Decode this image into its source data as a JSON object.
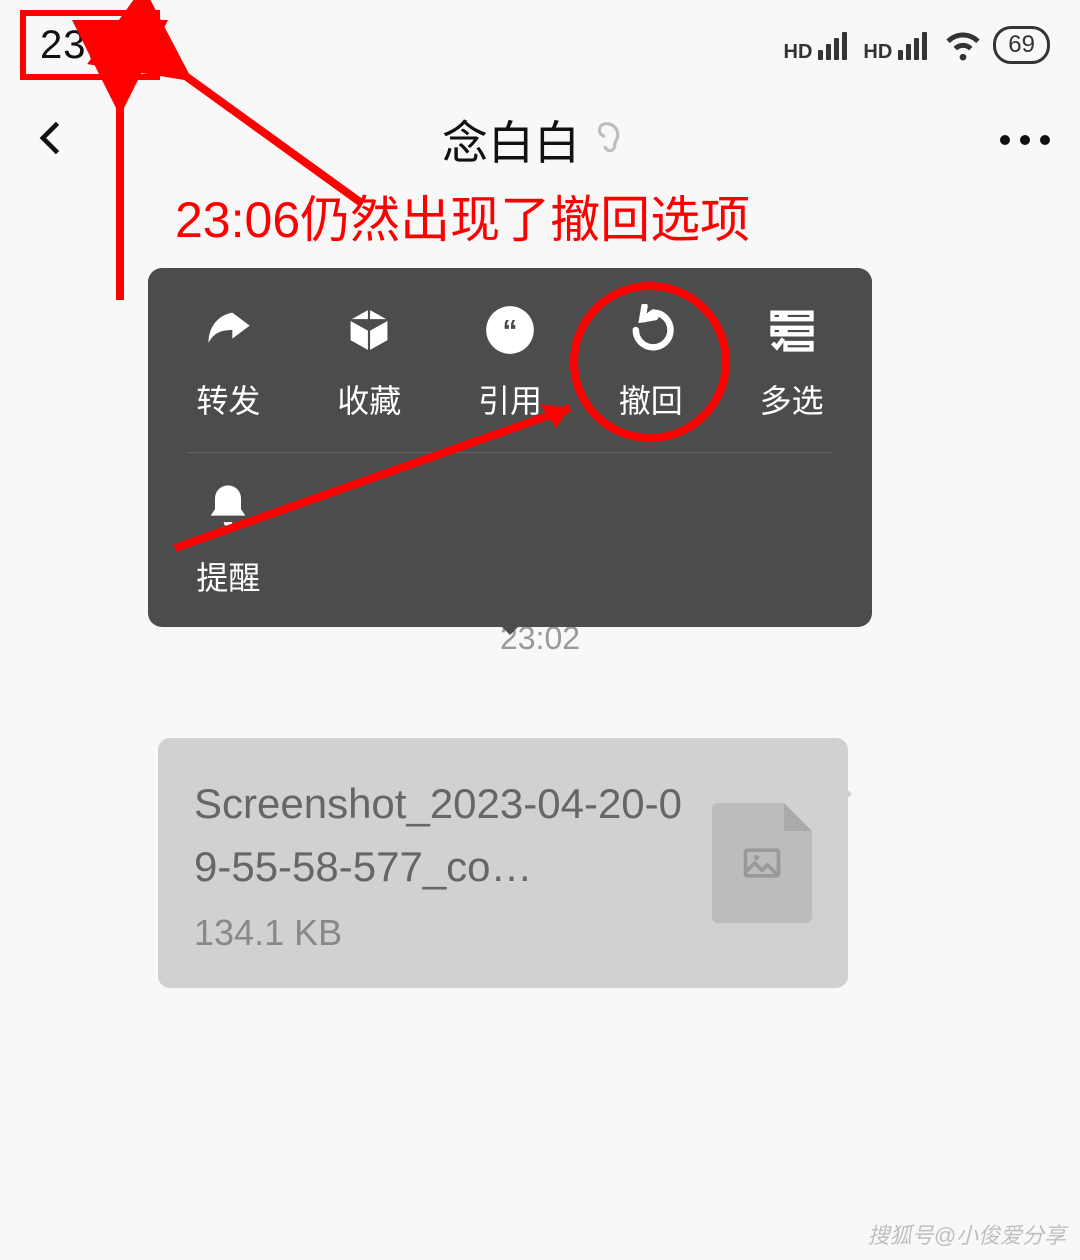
{
  "status": {
    "time": "23:06",
    "battery": "69",
    "hd": "HD"
  },
  "nav": {
    "title": "念白白"
  },
  "annotation": {
    "text": "23:06仍然出现了撤回选项"
  },
  "popup": {
    "items": [
      {
        "label": "转发",
        "icon": "forward-icon"
      },
      {
        "label": "收藏",
        "icon": "favorite-icon"
      },
      {
        "label": "引用",
        "icon": "quote-icon"
      },
      {
        "label": "撤回",
        "icon": "recall-icon"
      },
      {
        "label": "多选",
        "icon": "multiselect-icon"
      }
    ],
    "items2": [
      {
        "label": "提醒",
        "icon": "remind-icon"
      }
    ]
  },
  "chat": {
    "timestamp": "23:02",
    "file": {
      "name": "Screenshot_2023-04-20-09-55-58-577_co…",
      "size": "134.1 KB"
    }
  },
  "watermark": "搜狐号@小俊爱分享"
}
